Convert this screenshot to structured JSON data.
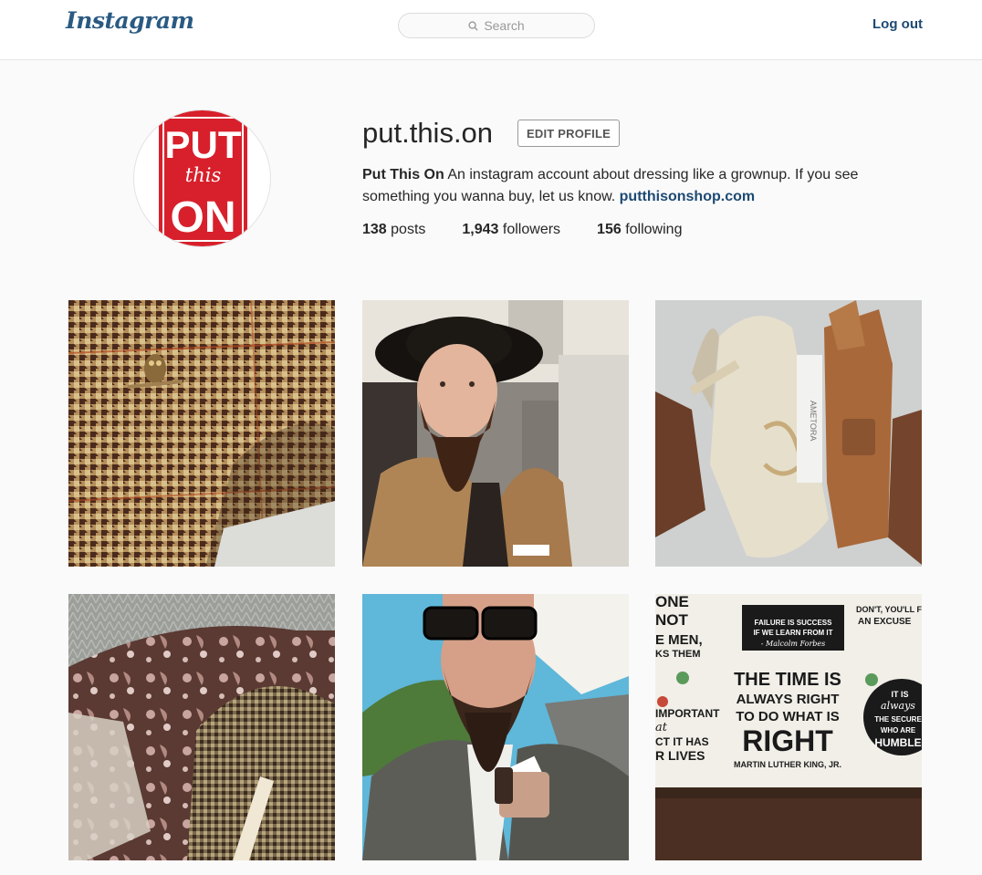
{
  "header": {
    "logo": "Instagram",
    "search_placeholder": "Search",
    "logout": "Log out"
  },
  "profile": {
    "username": "put.this.on",
    "edit_button": "EDIT PROFILE",
    "full_name": "Put This On",
    "bio": "An instagram account about dressing like a grownup. If you see something you wanna buy, let us know.",
    "website": "putthisonshop.com",
    "avatar_lines": [
      "PUT",
      "this",
      "ON"
    ],
    "stats": [
      {
        "count": "138",
        "label": "posts"
      },
      {
        "count": "1,943",
        "label": "followers"
      },
      {
        "count": "156",
        "label": "following"
      }
    ]
  },
  "posts": [
    {
      "subject": "houndstooth-tweed-jacket-owl-pin"
    },
    {
      "subject": "bearded-man-black-hat"
    },
    {
      "subject": "canvas-bag-leather-briefcase-book"
    },
    {
      "subject": "paisley-pocket-square-herringbone"
    },
    {
      "subject": "bearded-man-sunglasses-tweed"
    },
    {
      "subject": "motivational-quotes-wall",
      "quote_lines": [
        "THE TIME IS",
        "ALWAYS RIGHT",
        "TO DO WHAT IS",
        "RIGHT",
        "MARTIN LUTHER KING, JR."
      ],
      "side_lines": [
        "FAILURE IS SUCCESS",
        "IF WE LEARN FROM IT",
        "- Malcolm Forbes"
      ],
      "left_lines": [
        "ONE",
        "NOT",
        "E MEN,",
        "KS THEM",
        "IMPORTANT",
        "at",
        "CT IT HAS",
        "R LIVES"
      ],
      "right_lines": [
        "DON'T, YOU'LL FIND",
        "AN EXCUSE",
        "IT IS",
        "always",
        "THE SECURE",
        "WHO ARE",
        "HUMBLE"
      ]
    }
  ],
  "colors": {
    "accent": "#1d4a73",
    "avatar_red": "#d7202b"
  }
}
